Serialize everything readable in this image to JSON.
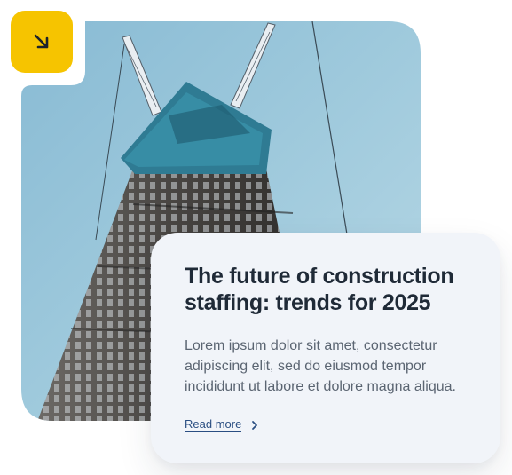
{
  "article": {
    "title": "The future of construction staffing: trends for 2025",
    "excerpt": "Lorem ipsum dolor sit amet, consectetur adipiscing elit, sed do eiusmod tempor incididunt ut labore et dolore magna aliqua.",
    "read_more_label": "Read more"
  },
  "icons": {
    "corner_badge": "arrow-down-right-icon",
    "read_more": "chevron-right-icon"
  },
  "colors": {
    "badge": "#f6c400",
    "card_bg": "#f1f4f9",
    "title": "#1f2a37",
    "body": "#5b6572",
    "link": "#2a4e82"
  }
}
